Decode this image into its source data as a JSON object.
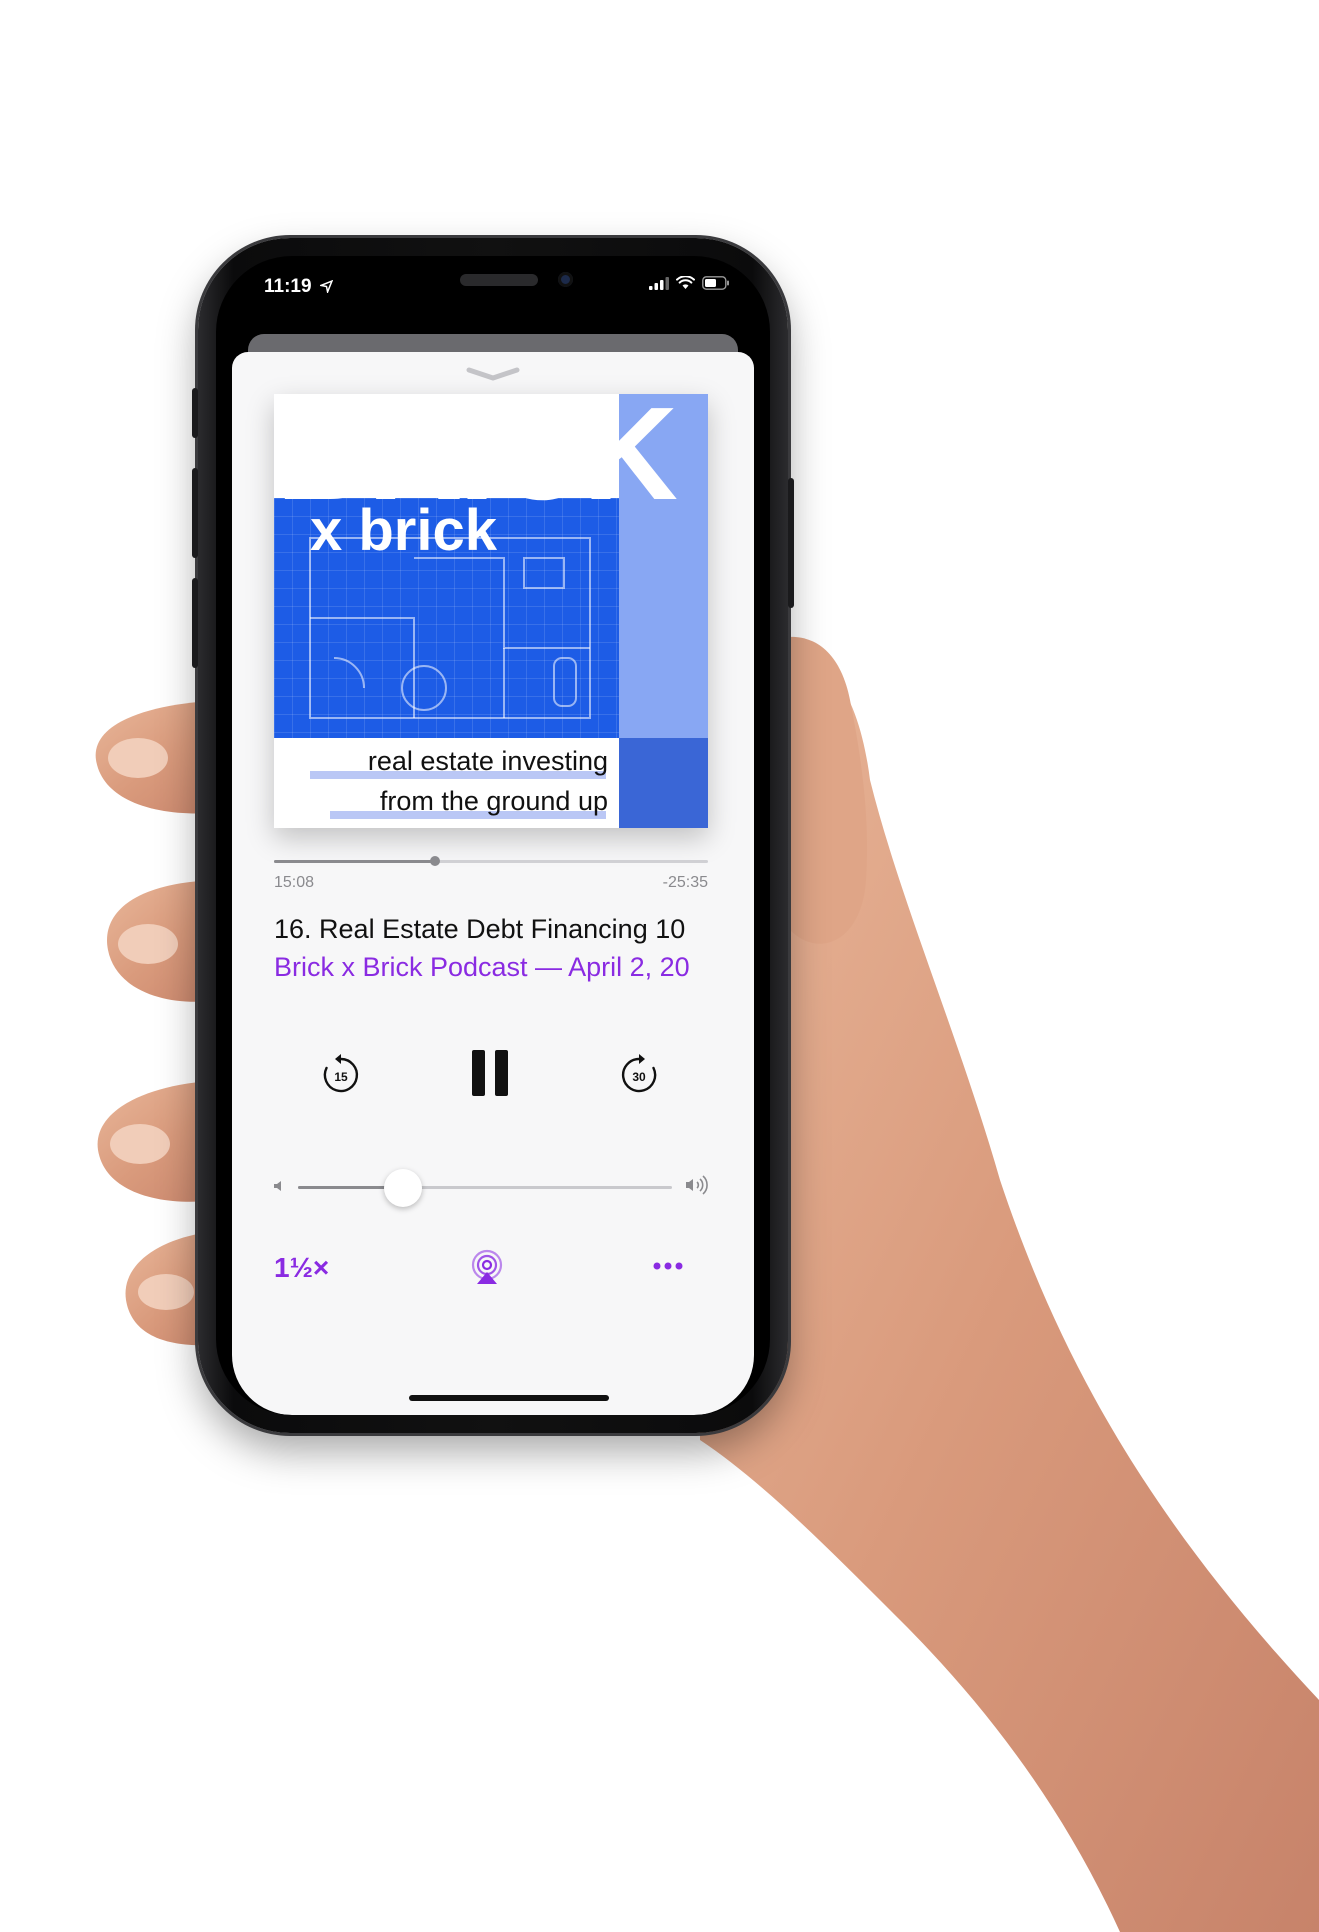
{
  "status_bar": {
    "time": "11:19"
  },
  "artwork": {
    "title_big": "BRICK",
    "title_small": "x brick",
    "tagline_line1": "real estate investing",
    "tagline_line2": "from the ground up"
  },
  "playback": {
    "elapsed": "15:08",
    "remaining": "-25:35",
    "progress": 0.37,
    "volume": 0.28
  },
  "episode": {
    "title": "16. Real Estate Debt Financing 10",
    "subtitle": "Brick x Brick Podcast — April 2, 20"
  },
  "controls": {
    "skip_back_seconds": "15",
    "skip_forward_seconds": "30",
    "speed": "1½×"
  },
  "colors": {
    "accent": "#8a2be2",
    "art_blue": "#1d5ce6",
    "art_light_blue": "#88a7f3",
    "art_dark_blue": "#3a66d6"
  }
}
